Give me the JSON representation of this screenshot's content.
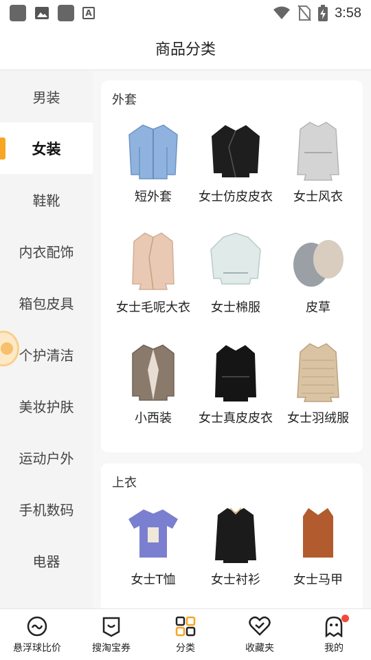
{
  "status_bar": {
    "time": "3:58",
    "icons": [
      "notification-icon",
      "gallery-icon",
      "app-icon",
      "a-icon",
      "wifi-icon",
      "no-sim-icon",
      "battery-charging-icon"
    ]
  },
  "header": {
    "title": "商品分类"
  },
  "sidebar": {
    "items": [
      {
        "label": "男装",
        "active": false
      },
      {
        "label": "女装",
        "active": true
      },
      {
        "label": "鞋靴",
        "active": false
      },
      {
        "label": "内衣配饰",
        "active": false
      },
      {
        "label": "箱包皮具",
        "active": false
      },
      {
        "label": "个护清洁",
        "active": false
      },
      {
        "label": "美妆护肤",
        "active": false
      },
      {
        "label": "运动户外",
        "active": false
      },
      {
        "label": "手机数码",
        "active": false
      },
      {
        "label": "电器",
        "active": false
      }
    ]
  },
  "sections": [
    {
      "title": "外套",
      "items": [
        {
          "label": "短外套",
          "icon": "denim-jacket-icon",
          "color": "#8fb3de"
        },
        {
          "label": "女士仿皮皮衣",
          "icon": "leather-jacket-icon",
          "color": "#1e1e1e"
        },
        {
          "label": "女士风衣",
          "icon": "trench-coat-icon",
          "color": "#d4d4d4"
        },
        {
          "label": "女士毛呢大衣",
          "icon": "wool-coat-icon",
          "color": "#e9c9b3"
        },
        {
          "label": "女士棉服",
          "icon": "padded-jacket-icon",
          "color": "#dfeae9"
        },
        {
          "label": "皮草",
          "icon": "fur-coat-icon",
          "color": "#9aa0a6"
        },
        {
          "label": "小西装",
          "icon": "blazer-icon",
          "color": "#8a7a6c"
        },
        {
          "label": "女士真皮皮衣",
          "icon": "real-leather-jacket-icon",
          "color": "#151515"
        },
        {
          "label": "女士羽绒服",
          "icon": "down-jacket-icon",
          "color": "#d9c3a3"
        }
      ]
    },
    {
      "title": "上衣",
      "items": [
        {
          "label": "女士T恤",
          "icon": "tshirt-icon",
          "color": "#7b7fd0"
        },
        {
          "label": "女士衬衫",
          "icon": "shirt-icon",
          "color": "#1b1b1b"
        },
        {
          "label": "女士马甲",
          "icon": "vest-icon",
          "color": "#b25b2e"
        }
      ]
    }
  ],
  "bottom_nav": {
    "items": [
      {
        "label": "悬浮球比价",
        "icon": "float-ball-icon"
      },
      {
        "label": "搜淘宝券",
        "icon": "coupon-icon"
      },
      {
        "label": "分类",
        "icon": "category-grid-icon"
      },
      {
        "label": "收藏夹",
        "icon": "heart-icon"
      },
      {
        "label": "我的",
        "icon": "profile-icon",
        "badge": true
      }
    ]
  },
  "colors": {
    "accent": "#f6a623",
    "badge": "#f24b3b"
  }
}
